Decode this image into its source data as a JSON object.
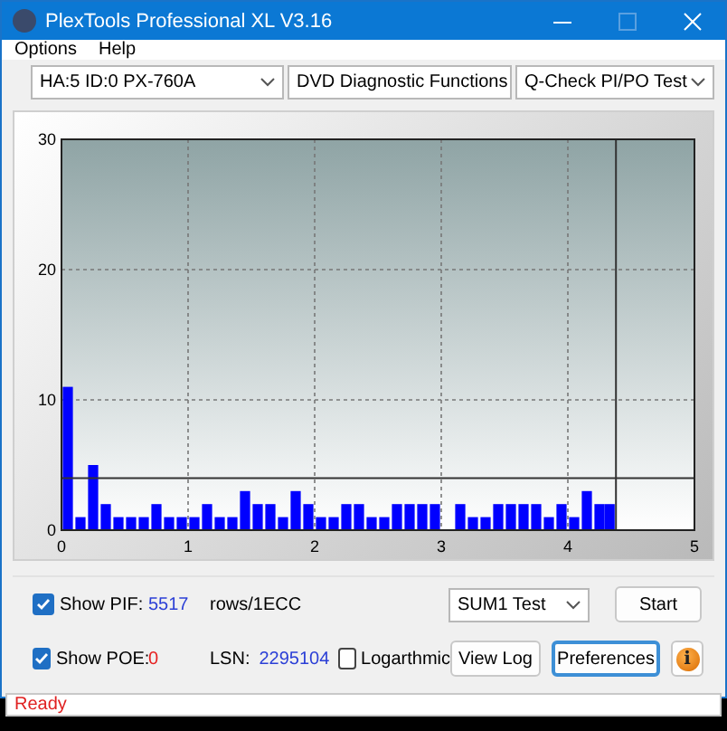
{
  "window": {
    "title": "PlexTools Professional XL V3.16"
  },
  "menu": [
    {
      "label": "Options"
    },
    {
      "label": "Help"
    }
  ],
  "selectors": [
    {
      "value": "HA:5 ID:0  PX-760A"
    },
    {
      "value": "DVD Diagnostic Functions"
    },
    {
      "value": "Q-Check PI/PO Test"
    }
  ],
  "chart": {
    "chart_data": {
      "type": "bar",
      "xlim": [
        0,
        5
      ],
      "ylim": [
        0,
        30
      ],
      "xticks": [
        0,
        1,
        2,
        3,
        4,
        5
      ],
      "yticks": [
        0,
        10,
        20,
        30
      ],
      "grid": true,
      "x": [
        0.05,
        0.15,
        0.25,
        0.35,
        0.45,
        0.55,
        0.65,
        0.75,
        0.85,
        0.95,
        1.05,
        1.15,
        1.25,
        1.35,
        1.45,
        1.55,
        1.65,
        1.75,
        1.85,
        1.95,
        2.05,
        2.15,
        2.25,
        2.35,
        2.45,
        2.55,
        2.65,
        2.75,
        2.85,
        2.95,
        3.05,
        3.15,
        3.25,
        3.35,
        3.45,
        3.55,
        3.65,
        3.75,
        3.85,
        3.95,
        4.05,
        4.15,
        4.25,
        4.33
      ],
      "series": [
        {
          "color": "#0000ff",
          "values": [
            11,
            1,
            5,
            2,
            1,
            1,
            1,
            2,
            1,
            1,
            1,
            2,
            1,
            1,
            3,
            2,
            2,
            1,
            3,
            2,
            1,
            1,
            2,
            2,
            1,
            1,
            2,
            2,
            2,
            2,
            0,
            2,
            1,
            1,
            2,
            2,
            2,
            2,
            1,
            2,
            1,
            3,
            2,
            2
          ]
        }
      ],
      "ref_lines": [
        {
          "axis": "y",
          "value": 4
        },
        {
          "axis": "x",
          "value": 4.38
        }
      ]
    }
  },
  "show_pif": {
    "label": "Show PIF:",
    "checked": true,
    "value": "5517",
    "unit": "rows/1ECC"
  },
  "show_poe": {
    "label": "Show POE:",
    "checked": true,
    "value": "0"
  },
  "lsn": {
    "label": "LSN:",
    "value": "2295104"
  },
  "logarithmic": {
    "label": "Logarthmic",
    "checked": false
  },
  "test_select": {
    "value": "SUM1 Test"
  },
  "buttons": [
    {
      "kind": "text",
      "label": "Start",
      "focused": false
    },
    {
      "kind": "text",
      "label": "View Log",
      "focused": false
    },
    {
      "kind": "text",
      "label": "Preferences",
      "focused": true
    },
    {
      "kind": "info",
      "label": "i",
      "focused": false
    }
  ],
  "status_bar": {
    "text": "Ready"
  }
}
